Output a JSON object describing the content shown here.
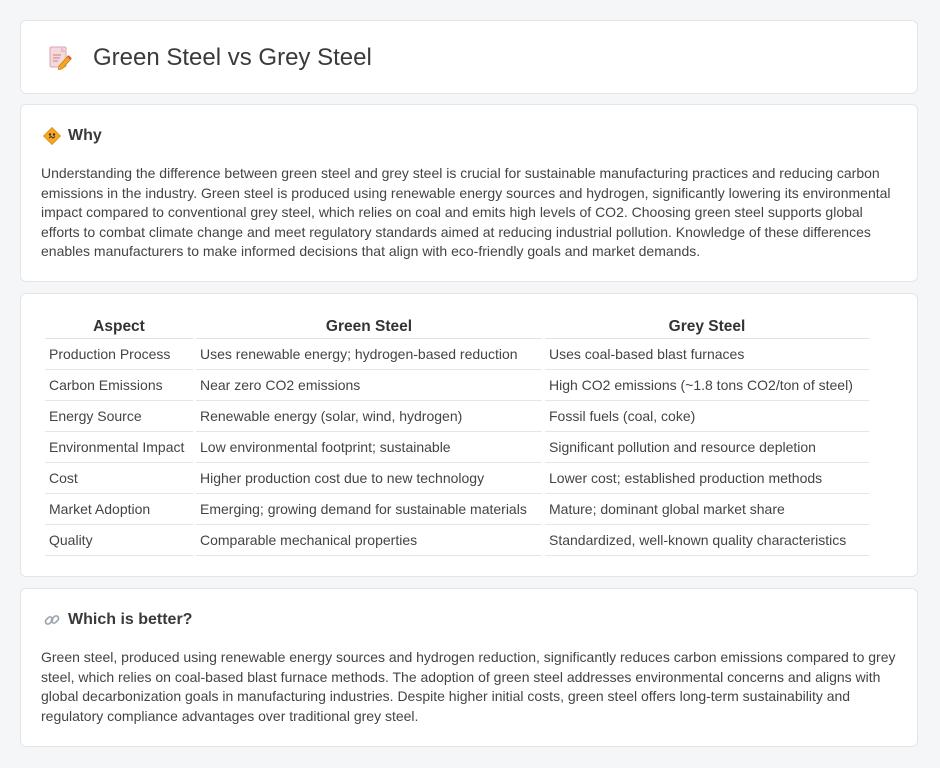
{
  "page": {
    "title": "Green Steel vs Grey Steel",
    "title_icon": "document-pencil-icon"
  },
  "why": {
    "title": "Why",
    "icon": "caution-sign-icon",
    "text": "Understanding the difference between green steel and grey steel is crucial for sustainable manufacturing practices and reducing carbon emissions in the industry. Green steel is produced using renewable energy sources and hydrogen, significantly lowering its environmental impact compared to conventional grey steel, which relies on coal and emits high levels of CO2. Choosing green steel supports global efforts to combat climate change and meet regulatory standards aimed at reducing industrial pollution. Knowledge of these differences enables manufacturers to make informed decisions that align with eco-friendly goals and market demands."
  },
  "table": {
    "headers": [
      "Aspect",
      "Green Steel",
      "Grey Steel"
    ],
    "rows": [
      [
        "Production Process",
        "Uses renewable energy; hydrogen-based reduction",
        "Uses coal-based blast furnaces"
      ],
      [
        "Carbon Emissions",
        "Near zero CO2 emissions",
        "High CO2 emissions (~1.8 tons CO2/ton of steel)"
      ],
      [
        "Energy Source",
        "Renewable energy (solar, wind, hydrogen)",
        "Fossil fuels (coal, coke)"
      ],
      [
        "Environmental Impact",
        "Low environmental footprint; sustainable",
        "Significant pollution and resource depletion"
      ],
      [
        "Cost",
        "Higher production cost due to new technology",
        "Lower cost; established production methods"
      ],
      [
        "Market Adoption",
        "Emerging; growing demand for sustainable materials",
        "Mature; dominant global market share"
      ],
      [
        "Quality",
        "Comparable mechanical properties",
        "Standardized, well-known quality characteristics"
      ]
    ]
  },
  "better": {
    "title": "Which is better?",
    "icon": "link-icon",
    "text": "Green steel, produced using renewable energy sources and hydrogen reduction, significantly reduces carbon emissions compared to grey steel, which relies on coal-based blast furnace methods. The adoption of green steel addresses environmental concerns and aligns with global decarbonization goals in manufacturing industries. Despite higher initial costs, green steel offers long-term sustainability and regulatory compliance advantages over traditional grey steel."
  },
  "colors": {
    "background": "#f5f6f8",
    "card": "#ffffff",
    "border": "#e2e5ea",
    "text": "#444444",
    "icon_orange": "#f5a623",
    "icon_pink": "#e8a0a8"
  }
}
